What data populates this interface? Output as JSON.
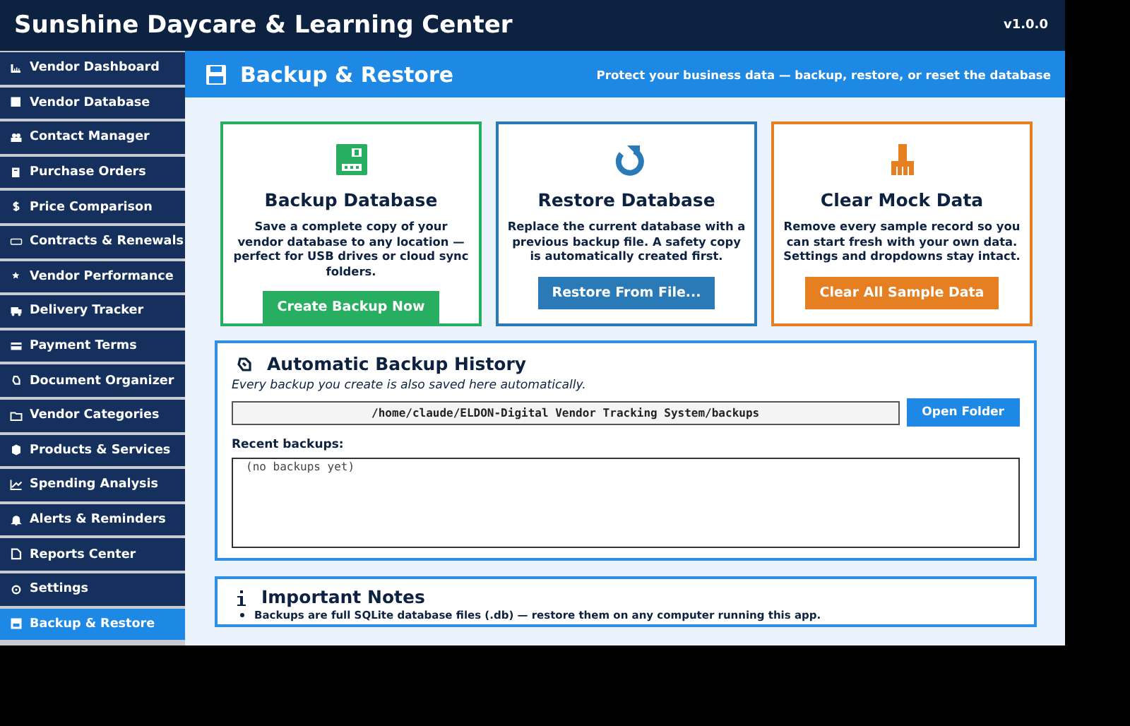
{
  "window": {
    "title": "Sunshine Daycare & Learning Center",
    "version": "v1.0.0"
  },
  "sidebar": {
    "items": [
      {
        "label": "Vendor Dashboard",
        "selected": false
      },
      {
        "label": "Vendor Database",
        "selected": false
      },
      {
        "label": "Contact Manager",
        "selected": false
      },
      {
        "label": "Purchase Orders",
        "selected": false
      },
      {
        "label": "Price Comparison",
        "selected": false
      },
      {
        "label": "Contracts & Renewals",
        "selected": false
      },
      {
        "label": "Vendor Performance",
        "selected": false
      },
      {
        "label": "Delivery Tracker",
        "selected": false
      },
      {
        "label": "Payment Terms",
        "selected": false
      },
      {
        "label": "Document Organizer",
        "selected": false
      },
      {
        "label": "Vendor Categories",
        "selected": false
      },
      {
        "label": "Products & Services",
        "selected": false
      },
      {
        "label": "Spending Analysis",
        "selected": false
      },
      {
        "label": "Alerts & Reminders",
        "selected": false
      },
      {
        "label": "Reports Center",
        "selected": false
      },
      {
        "label": "Settings",
        "selected": false
      },
      {
        "label": "Backup & Restore",
        "selected": true
      }
    ]
  },
  "page_header": {
    "title": "Backup & Restore",
    "subtitle": "Protect your business data — backup, restore, or reset the database"
  },
  "cards": [
    {
      "kind": "backup",
      "color": "#27ae60",
      "title": "Backup Database",
      "text": "Save a complete copy of your vendor database to any location — perfect for USB drives or cloud sync folders.",
      "button": "Create Backup Now"
    },
    {
      "kind": "restore",
      "color": "#2a7ab8",
      "title": "Restore Database",
      "text": "Replace the current database with a previous backup file. A safety copy is automatically created first.",
      "button": "Restore From File..."
    },
    {
      "kind": "clear",
      "color": "#e67e22",
      "title": "Clear Mock Data",
      "text": "Remove every sample record so you can start fresh with your own data. Settings and dropdowns stay intact.",
      "button": "Clear All Sample Data"
    }
  ],
  "history": {
    "title": "Automatic Backup History",
    "note": "Every backup you create is also saved here automatically.",
    "path": "/home/claude/ELDON-Digital Vendor Tracking System/backups",
    "button": "Open Folder",
    "list_label": "Recent backups:",
    "list": [
      "(no backups yet)"
    ]
  },
  "notes": {
    "title": "Important Notes",
    "items": [
      "Backups are full SQLite database files (.db) — restore them on any computer running this app."
    ]
  }
}
